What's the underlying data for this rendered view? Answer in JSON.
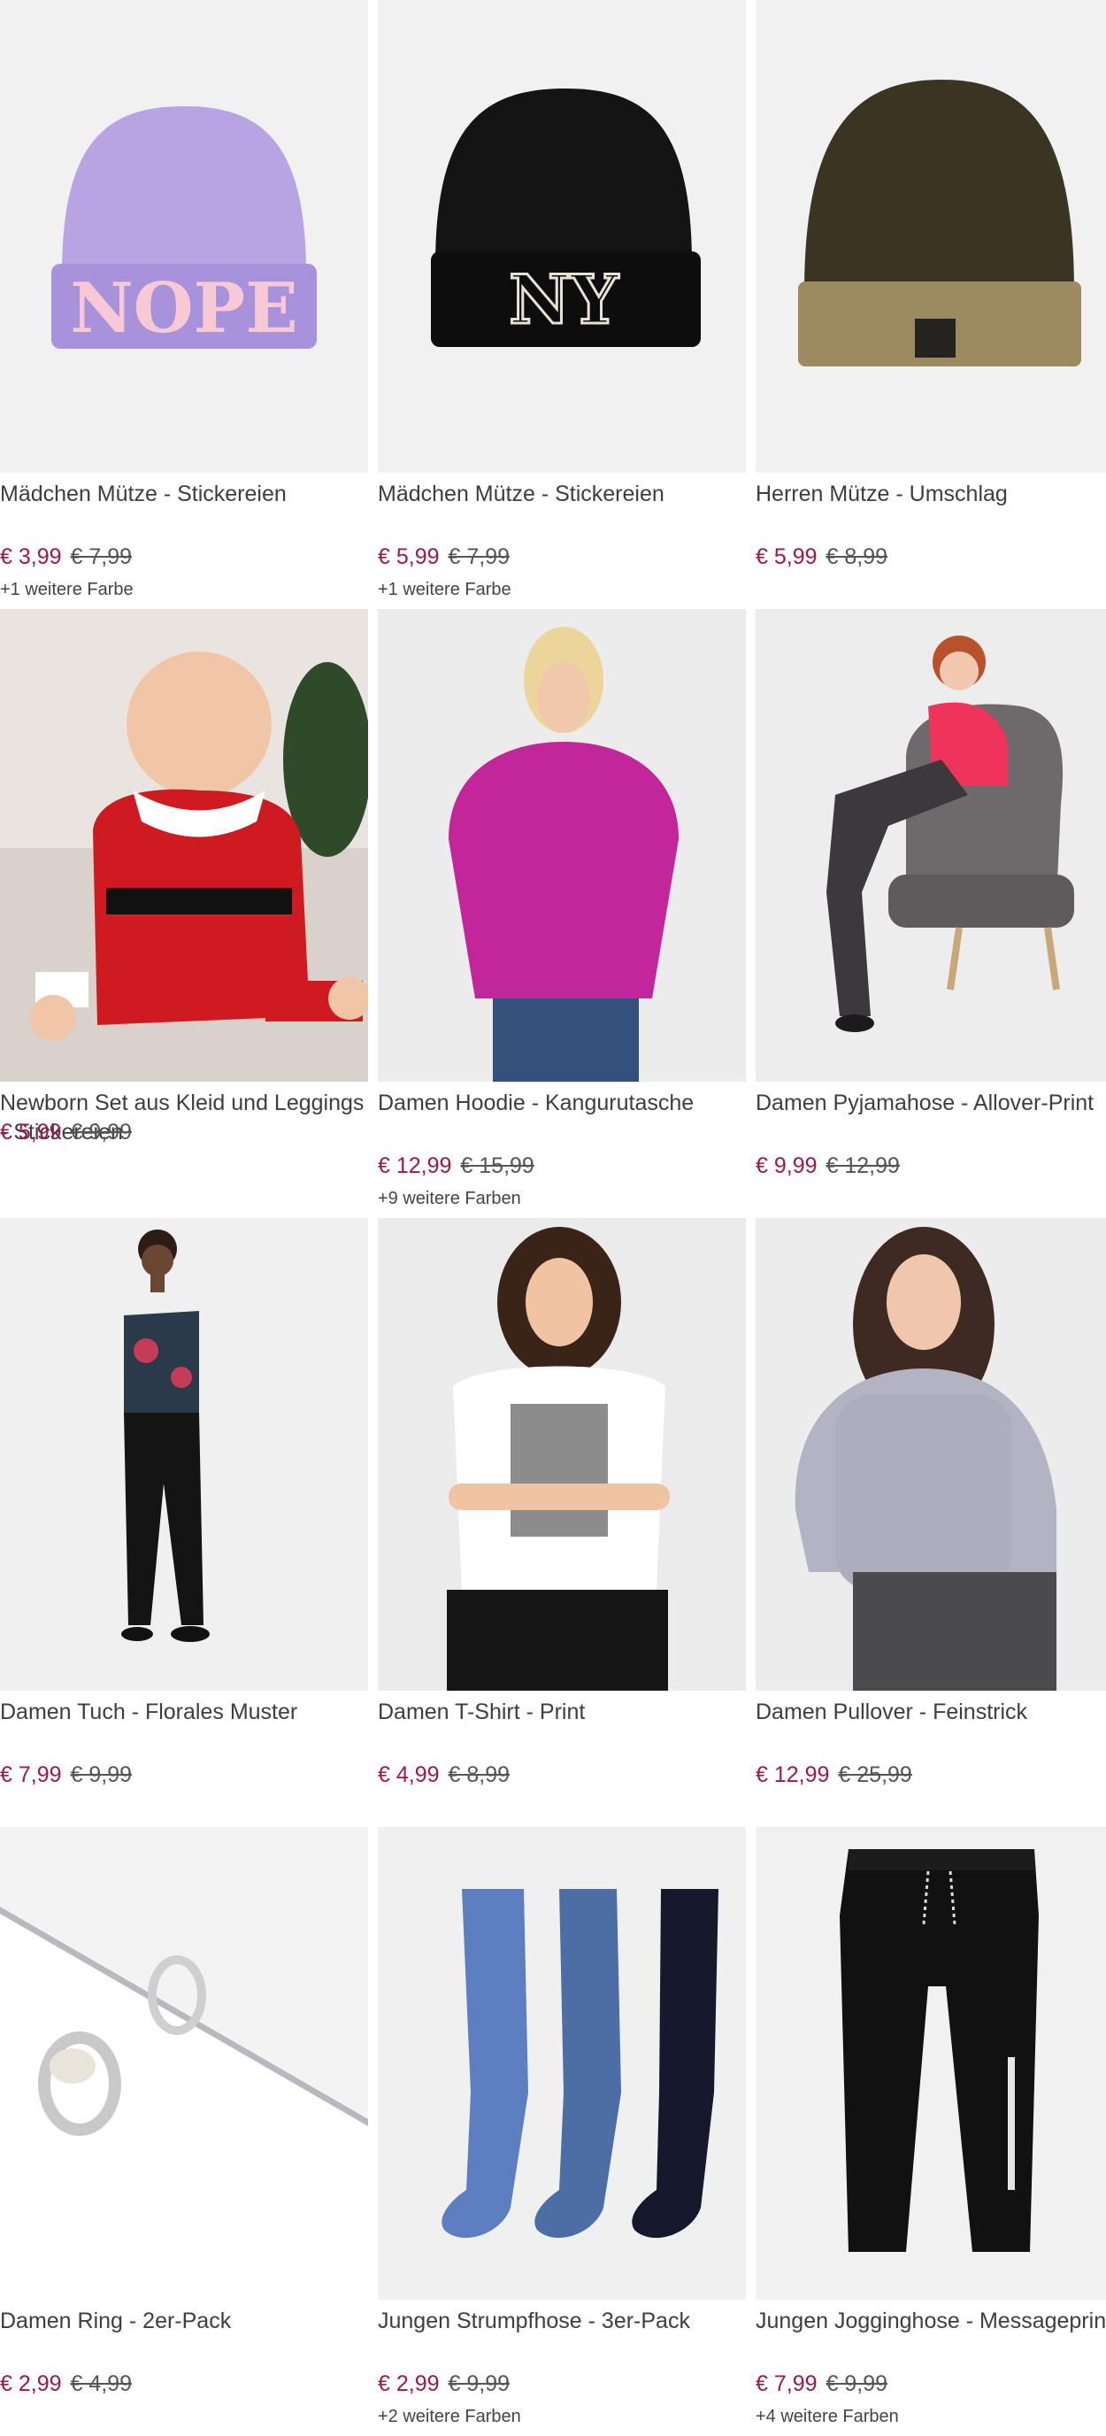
{
  "products": [
    {
      "title": "Mädchen Mütze - Stickereien",
      "price": "€ 3,99",
      "old_price": "€ 7,99",
      "colors": "+1 weitere Farbe",
      "image": "lilac-beanie-nope"
    },
    {
      "title": "Mädchen Mütze - Stickereien",
      "price": "€ 5,99",
      "old_price": "€ 7,99",
      "colors": "+1 weitere Farbe",
      "image": "black-beanie-ny"
    },
    {
      "title": "Herren Mütze - Umschlag",
      "price": "€ 5,99",
      "old_price": "€ 8,99",
      "colors": "",
      "image": "olive-beanie-cuff"
    },
    {
      "title": "Newborn Set aus Kleid und Leggings - Stickereien",
      "price": "€ 5,99",
      "old_price": "€ 9,99",
      "colors": "",
      "image": "baby-red-dress"
    },
    {
      "title": "Damen Hoodie - Kangurutasche",
      "price": "€ 12,99",
      "old_price": "€ 15,99",
      "colors": "+9 weitere Farben",
      "image": "woman-magenta-hoodie"
    },
    {
      "title": "Damen Pyjamahose - Allover-Print",
      "price": "€ 9,99",
      "old_price": "€ 12,99",
      "colors": "",
      "image": "woman-pyjama-chair"
    },
    {
      "title": "Damen Tuch - Florales Muster",
      "price": "€ 7,99",
      "old_price": "€ 9,99",
      "colors": "",
      "image": "woman-floral-scarf-top"
    },
    {
      "title": "Damen T-Shirt - Print",
      "price": "€ 4,99",
      "old_price": "€ 8,99",
      "colors": "",
      "image": "woman-white-tshirt"
    },
    {
      "title": "Damen Pullover - Feinstrick",
      "price": "€ 12,99",
      "old_price": "€ 25,99",
      "colors": "",
      "image": "woman-grey-pullover"
    },
    {
      "title": "Damen Ring - 2er-Pack",
      "price": "€ 2,99",
      "old_price": "€ 4,99",
      "colors": "",
      "image": "silver-rings"
    },
    {
      "title": "Jungen Strumpfhose - 3er-Pack",
      "price": "€ 2,99",
      "old_price": "€ 9,99",
      "colors": "+2 weitere Farben",
      "image": "blue-tights-3pack"
    },
    {
      "title": "Jungen Jogginghose - Messageprint",
      "price": "€ 7,99",
      "old_price": "€ 9,99",
      "colors": "+4 weitere Farben",
      "image": "black-joggers"
    }
  ],
  "beanie_texts": {
    "nope": "NOPE",
    "ny": "NY"
  },
  "colors": {
    "price": "#a0184a",
    "background": "#efefef"
  }
}
